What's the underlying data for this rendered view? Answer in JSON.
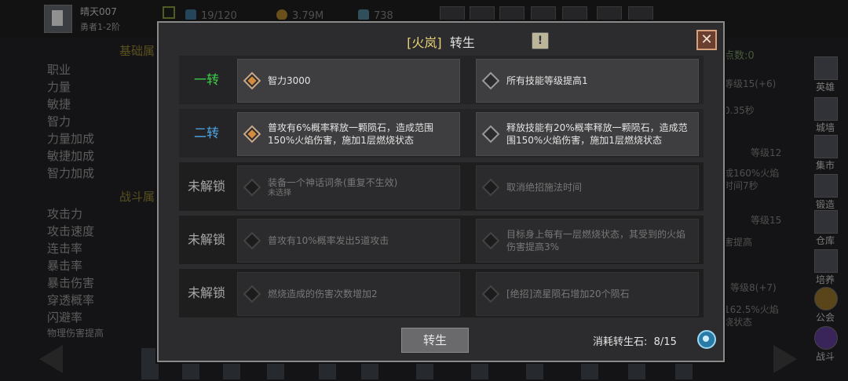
{
  "player": {
    "name": "晴天007",
    "rank": "勇者1-2阶"
  },
  "top_stats": [
    "19/120",
    "3.79M",
    "738"
  ],
  "left_sections": [
    "基础属",
    "战斗属"
  ],
  "left_labels": [
    "职业",
    "力量",
    "敏捷",
    "智力",
    "力量加成",
    "敏捷加成",
    "智力加成",
    "攻击力",
    "攻击速度",
    "连击率",
    "暴击率",
    "暴击伤害",
    "穿透概率",
    "闪避率",
    "物理伤害提高"
  ],
  "right_panel": {
    "points": "点数:0",
    "items": [
      "等级15(+6)",
      "0.35秒",
      "等级12",
      "成160%火焰",
      "时间7秒",
      "等级15",
      "害提高",
      "等级8(+7)",
      "162.5%火焰",
      "烧状态"
    ]
  },
  "side_menu": [
    "英雄",
    "城墙",
    "集市",
    "锻造",
    "仓库",
    "培养",
    "公会",
    "战斗"
  ],
  "modal": {
    "title_bracket_open": "[",
    "title_class": "火岚",
    "title_bracket_close": "]",
    "title_text": "转生",
    "help_label": "!",
    "close_label": "✕",
    "rows": [
      {
        "label": "一转",
        "label_color": "#3ecf4a",
        "locked": false,
        "left": {
          "text": "智力3000",
          "sub": "",
          "selected": true
        },
        "right": {
          "text": "所有技能等级提高1",
          "sub": "",
          "selected": false
        }
      },
      {
        "label": "二转",
        "label_color": "#4ea6e6",
        "locked": false,
        "left": {
          "text": "普攻有6%概率释放一颗陨石，造成范围150%火焰伤害，施加1层燃烧状态",
          "sub": "",
          "selected": true
        },
        "right": {
          "text": "释放技能有20%概率释放一颗陨石，造成范围150%火焰伤害，施加1层燃烧状态",
          "sub": "",
          "selected": false
        }
      },
      {
        "label": "未解锁",
        "label_color": "#a8a8a8",
        "locked": true,
        "left": {
          "text": "装备一个神话词条(重复不生效)",
          "sub": "未选择",
          "selected": false
        },
        "right": {
          "text": "取消绝招施法时间",
          "sub": "",
          "selected": false
        }
      },
      {
        "label": "未解锁",
        "label_color": "#a8a8a8",
        "locked": true,
        "left": {
          "text": "普攻有10%概率发出5道攻击",
          "sub": "",
          "selected": false
        },
        "right": {
          "text": "目标身上每有一层燃烧状态，其受到的火焰伤害提高3%",
          "sub": "",
          "selected": false
        }
      },
      {
        "label": "未解锁",
        "label_color": "#a8a8a8",
        "locked": true,
        "left": {
          "text": "燃烧造成的伤害次数增加2",
          "sub": "",
          "selected": false
        },
        "right": {
          "text": "[绝招]流星陨石增加20个陨石",
          "sub": "",
          "selected": false
        }
      }
    ],
    "rebirth_button": "转生",
    "cost_label": "消耗转生石:",
    "cost_value": "8/15"
  }
}
